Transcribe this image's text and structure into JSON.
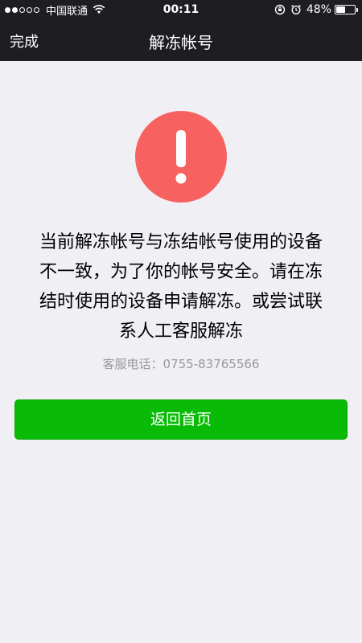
{
  "status_bar": {
    "signal_filled": 2,
    "signal_total": 5,
    "carrier": "中国联通",
    "time": "00:11",
    "battery_percent": "48%",
    "battery_level": 0.48
  },
  "nav": {
    "done_label": "完成",
    "title": "解冻帐号"
  },
  "alert": {
    "icon": "exclamation-icon",
    "color": "#f76260",
    "message_lines": [
      "当前解冻帐号与冻结帐号使用的设备",
      "不一致，为了你的帐号安全。请在冻",
      "结时使用的设备申请解冻。或尝试联",
      "系人工客服解冻"
    ],
    "hotline": "客服电话：0755-83765566"
  },
  "action": {
    "home_label": "返回首页",
    "color": "#09bb07"
  }
}
